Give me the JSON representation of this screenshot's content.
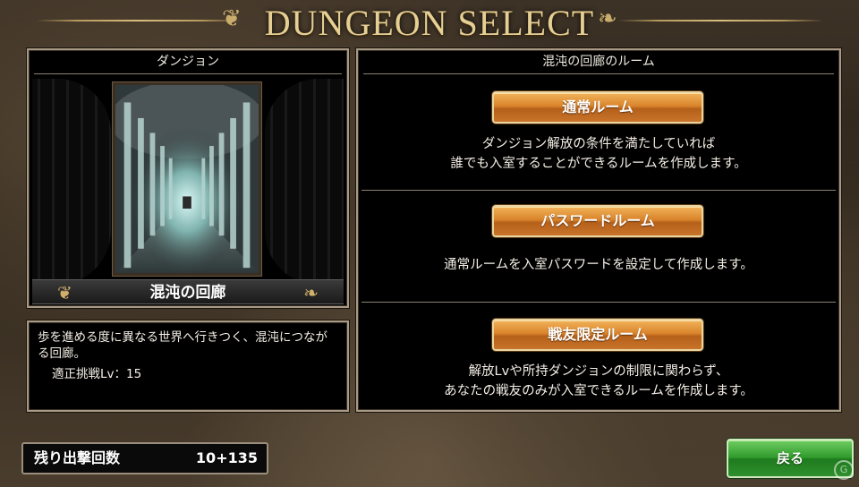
{
  "header": {
    "title": "DUNGEON SELECT"
  },
  "dungeon": {
    "section_label": "ダンジョン",
    "name": "混沌の回廊",
    "image_icon": "corridor-of-pillars-illustration"
  },
  "description": {
    "text": "歩を進める度に異なる世界へ行きつく、混沌につながる回廊。",
    "recommended_lv": "適正挑戦Lv：15"
  },
  "rooms": {
    "section_label": "混沌の回廊のルーム",
    "items": [
      {
        "label": "通常ルーム",
        "desc_line1": "ダンジョン解放の条件を満たしていれば",
        "desc_line2": "誰でも入室することができるルームを作成します。"
      },
      {
        "label": "パスワードルーム",
        "desc_line1": "通常ルームを入室パスワードを設定して作成します。",
        "desc_line2": ""
      },
      {
        "label": "戦友限定ルーム",
        "desc_line1": "解放Lvや所持ダンジョンの制限に関わらず、",
        "desc_line2": "あなたの戦友のみが入室できるルームを作成します。"
      }
    ]
  },
  "footer": {
    "sortie_label": "残り出撃回数",
    "sortie_value": "10+135",
    "back_label": "戻る"
  },
  "colors": {
    "title_gold": "#e6cf93",
    "orange_button": "#d9842b",
    "green_button": "#2f9a2b",
    "panel_bg": "#000000"
  }
}
